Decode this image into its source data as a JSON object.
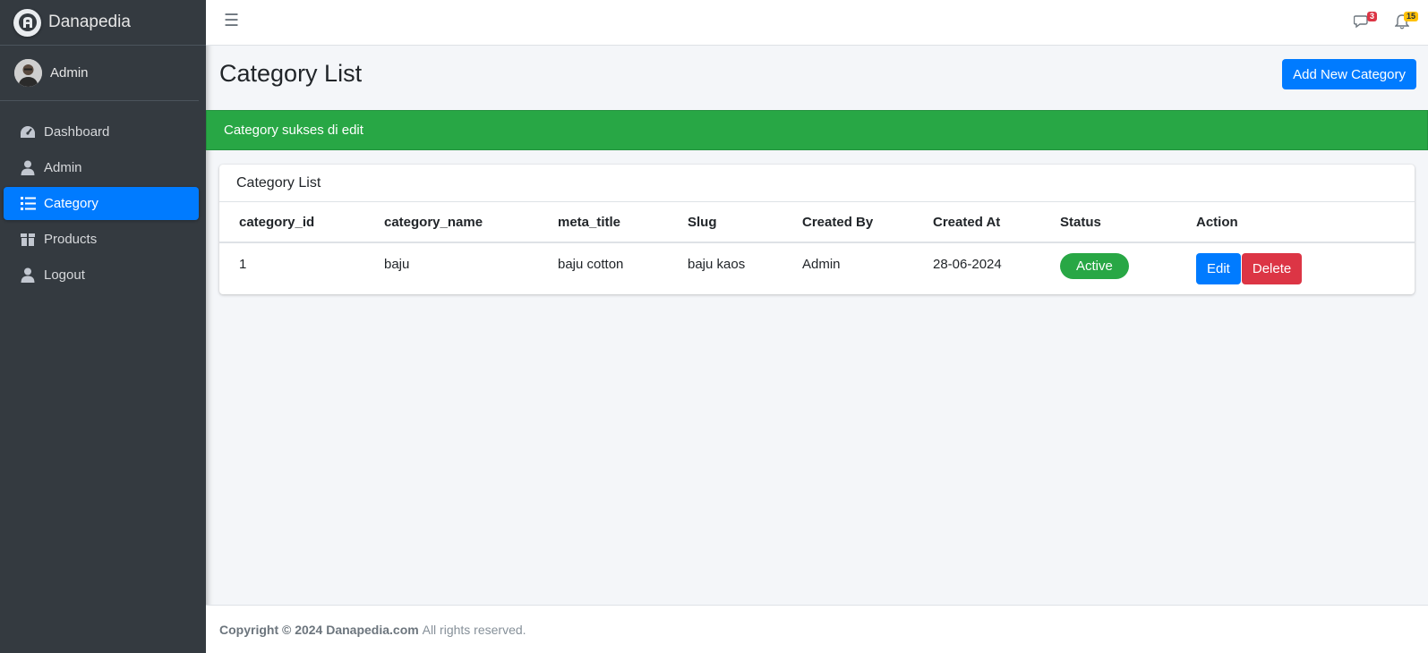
{
  "brand": {
    "name": "Danapedia"
  },
  "user": {
    "name": "Admin"
  },
  "sidebar": {
    "items": [
      {
        "label": "Dashboard",
        "icon": "gauge-icon",
        "active": false
      },
      {
        "label": "Admin",
        "icon": "user-icon",
        "active": false
      },
      {
        "label": "Category",
        "icon": "list-icon",
        "active": true
      },
      {
        "label": "Products",
        "icon": "box-icon",
        "active": false
      },
      {
        "label": "Logout",
        "icon": "user-icon",
        "active": false
      }
    ]
  },
  "topbar": {
    "messages_count": "3",
    "notifications_count": "15"
  },
  "page": {
    "title": "Category List",
    "add_button": "Add New Category",
    "alert": "Category sukses di edit"
  },
  "card": {
    "title": "Category List",
    "columns": [
      "category_id",
      "category_name",
      "meta_title",
      "Slug",
      "Created By",
      "Created At",
      "Status",
      "Action"
    ],
    "rows": [
      {
        "category_id": "1",
        "category_name": "baju",
        "meta_title": "baju cotton",
        "slug": "baju kaos",
        "created_by": "Admin",
        "created_at": "28-06-2024",
        "status": "Active",
        "edit_label": "Edit",
        "delete_label": "Delete"
      }
    ]
  },
  "footer": {
    "copyright": "Copyright © 2024 Danapedia.com",
    "rights": "All rights reserved."
  },
  "colors": {
    "sidebar": "#343a40",
    "primary": "#007bff",
    "success": "#28a745",
    "danger": "#dc3545",
    "warning": "#ffc107"
  }
}
